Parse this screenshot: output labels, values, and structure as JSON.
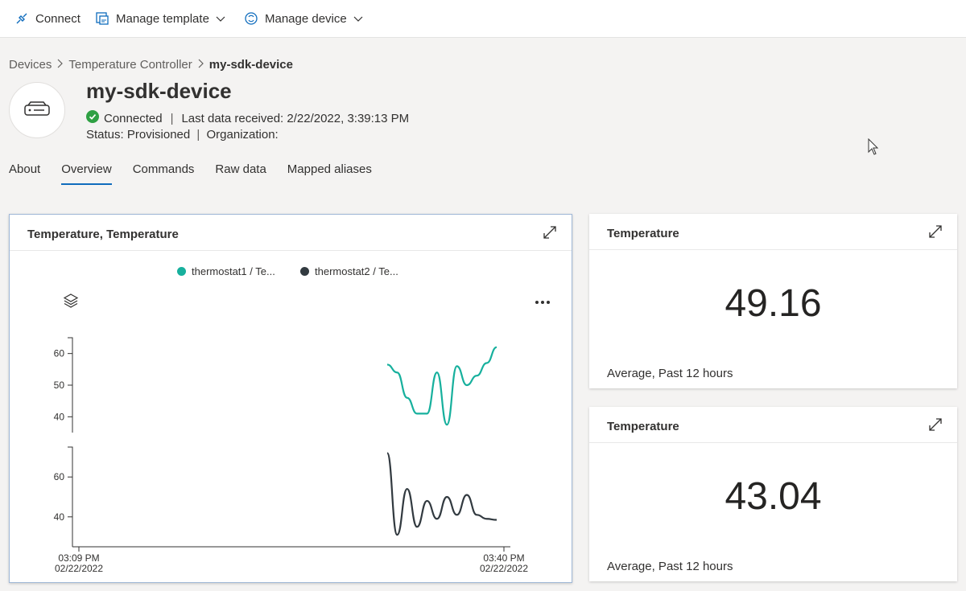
{
  "toolbar": {
    "connect": "Connect",
    "manage_template": "Manage template",
    "manage_device": "Manage device"
  },
  "breadcrumb": [
    "Devices",
    "Temperature Controller",
    "my-sdk-device"
  ],
  "device": {
    "name": "my-sdk-device",
    "connection": "Connected",
    "last_data": "Last data received: 2/22/2022, 3:39:13 PM",
    "status": "Status: Provisioned",
    "organization": "Organization:"
  },
  "tabs": [
    "About",
    "Overview",
    "Commands",
    "Raw data",
    "Mapped aliases"
  ],
  "active_tab": "Overview",
  "chart_card": {
    "title": "Temperature, Temperature",
    "legend": [
      "thermostat1 / Te...",
      "thermostat2 / Te..."
    ],
    "x_start": [
      "03:09 PM",
      "02/22/2022"
    ],
    "x_end": [
      "03:40 PM",
      "02/22/2022"
    ]
  },
  "tile1": {
    "title": "Temperature",
    "value": "49.16",
    "caption": "Average, Past 12 hours"
  },
  "tile2": {
    "title": "Temperature",
    "value": "43.04",
    "caption": "Average, Past 12 hours"
  },
  "colors": {
    "series1": "#17b09d",
    "series2": "#323a40",
    "accent": "#0f6cbd",
    "connected": "#2ea043"
  },
  "chart_data": {
    "type": "line",
    "title": "Temperature, Temperature",
    "x_range": [
      "03:09 PM 02/22/2022",
      "03:40 PM 02/22/2022"
    ],
    "series": [
      {
        "name": "thermostat1 / Te...",
        "ylim": [
          35,
          65
        ],
        "y_ticks": [
          40,
          50,
          60
        ],
        "x": [
          "03:34",
          "03:35",
          "03:35",
          "03:36",
          "03:36",
          "03:37",
          "03:37",
          "03:38",
          "03:38",
          "03:39",
          "03:39",
          "03:40"
        ],
        "values": [
          56.5,
          54,
          46,
          41,
          41,
          54,
          37.5,
          56,
          50,
          53,
          57,
          62
        ]
      },
      {
        "name": "thermostat2 / Te...",
        "ylim": [
          25,
          75
        ],
        "y_ticks": [
          40,
          60
        ],
        "x": [
          "03:34",
          "03:35",
          "03:35",
          "03:36",
          "03:36",
          "03:37",
          "03:37",
          "03:38",
          "03:38",
          "03:39",
          "03:39",
          "03:40"
        ],
        "values": [
          72,
          31,
          54,
          35,
          48,
          39,
          50,
          41,
          51,
          41,
          39,
          38.5
        ]
      }
    ]
  }
}
